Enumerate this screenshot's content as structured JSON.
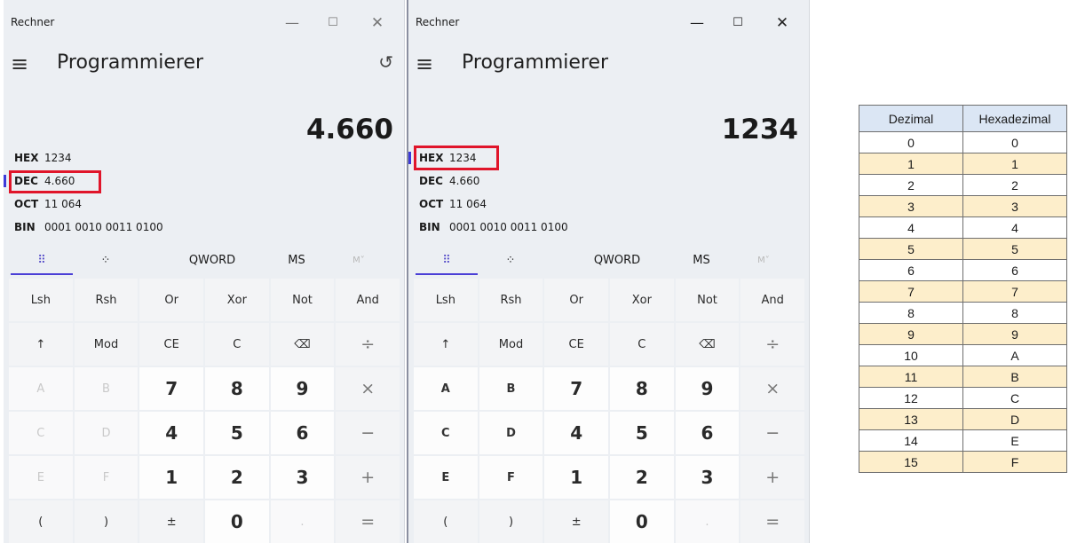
{
  "left": {
    "app_title": "Rechner",
    "mode_title": "Programmierer",
    "display": "4.660",
    "radix": [
      {
        "label": "HEX",
        "value": "1234"
      },
      {
        "label": "DEC",
        "value": "4.660"
      },
      {
        "label": "OCT",
        "value": "11 064"
      },
      {
        "label": "BIN",
        "value": "0001 0010 0011 0100"
      }
    ],
    "toolbar": {
      "keypad": "⠿",
      "bit": "⁘",
      "word": "QWORD",
      "ms": "MS",
      "mr": "M˅"
    }
  },
  "right": {
    "app_title": "Rechner",
    "mode_title": "Programmierer",
    "display": "1234",
    "radix": [
      {
        "label": "HEX",
        "value": "1234"
      },
      {
        "label": "DEC",
        "value": "4.660"
      },
      {
        "label": "OCT",
        "value": "11 064"
      },
      {
        "label": "BIN",
        "value": "0001 0010 0011 0100"
      }
    ],
    "toolbar": {
      "keypad": "⠿",
      "bit": "⁘",
      "word": "QWORD",
      "ms": "MS",
      "mr": "M˅"
    }
  },
  "window_controls": {
    "minimize": "—",
    "maximize": "☐",
    "close": "✕"
  },
  "icons": {
    "menu": "≡",
    "history": "↺"
  },
  "keys": [
    [
      "Lsh",
      "Rsh",
      "Or",
      "Xor",
      "Not",
      "And"
    ],
    [
      "↑",
      "Mod",
      "CE",
      "C",
      "⌫",
      "÷"
    ],
    [
      "A",
      "B",
      "7",
      "8",
      "9",
      "×"
    ],
    [
      "C",
      "D",
      "4",
      "5",
      "6",
      "−"
    ],
    [
      "E",
      "F",
      "1",
      "2",
      "3",
      "+"
    ],
    [
      "(",
      ")",
      "±",
      "0",
      ".",
      "="
    ]
  ],
  "lookup_table": {
    "headers": [
      "Dezimal",
      "Hexadezimal"
    ],
    "rows": [
      [
        "0",
        "0"
      ],
      [
        "1",
        "1"
      ],
      [
        "2",
        "2"
      ],
      [
        "3",
        "3"
      ],
      [
        "4",
        "4"
      ],
      [
        "5",
        "5"
      ],
      [
        "6",
        "6"
      ],
      [
        "7",
        "7"
      ],
      [
        "8",
        "8"
      ],
      [
        "9",
        "9"
      ],
      [
        "10",
        "A"
      ],
      [
        "11",
        "B"
      ],
      [
        "12",
        "C"
      ],
      [
        "13",
        "D"
      ],
      [
        "14",
        "E"
      ],
      [
        "15",
        "F"
      ]
    ]
  },
  "colors": {
    "highlight_box": "#e0152a",
    "accent": "#4a3fd6",
    "table_header": "#dbe6f4",
    "table_alt_row": "#fdeecb"
  }
}
